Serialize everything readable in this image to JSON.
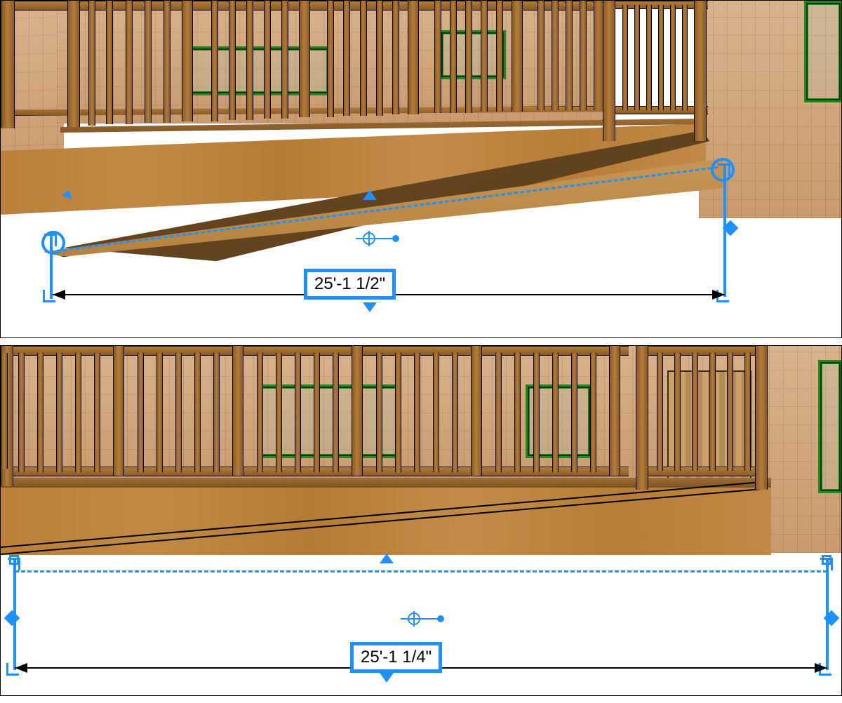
{
  "colors": {
    "selection": "#1e90ff",
    "wood_light": "#c08a45",
    "wood_dark": "#8a5a22",
    "shingle": "#d2a878",
    "window_frame": "#1e8a1e"
  },
  "top_view": {
    "type": "perspective_camera",
    "dimension_value": "25'-1 1/2\"",
    "selected_object": "ramp",
    "handles": [
      "move",
      "rotate",
      "extend-left",
      "extend-right",
      "center",
      "flip"
    ]
  },
  "bottom_view": {
    "type": "elevation_camera",
    "dimension_value": "25'-1 1/4\"",
    "selected_object": "ramp",
    "handles": [
      "move",
      "extend-left",
      "extend-right",
      "center",
      "flip"
    ]
  }
}
